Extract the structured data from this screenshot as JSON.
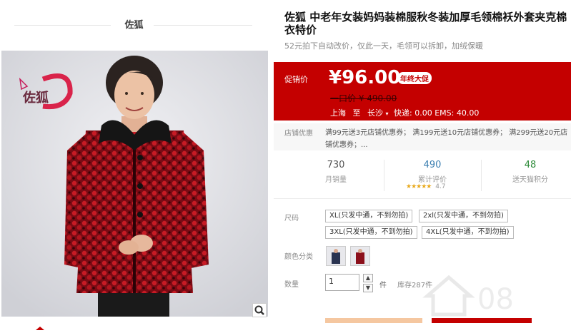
{
  "shop": {
    "name": "佐狐"
  },
  "product": {
    "title": "佐狐 中老年女装妈妈装棉服秋冬装加厚毛领棉袄外套夹克棉衣特价",
    "subtitle": "52元拍下自动改价，仅此一天，毛领可以拆卸，加绒保暖",
    "logo_text": "佐狐"
  },
  "price": {
    "promo_label": "促销价",
    "value": "¥96.00",
    "badge": "年终大促",
    "original": "一口价 ¥ 490.00",
    "shipping_from": "上海",
    "shipping_to_word": "至",
    "shipping_dest": "长沙",
    "shipping_text": "快递: 0.00 EMS: 40.00"
  },
  "coupon": {
    "label": "店铺优惠",
    "text": "满99元送3元店铺优惠券； 满199元送10元店铺优惠券； 满299元送20元店铺优惠券；..."
  },
  "stats": [
    {
      "value": "730",
      "label": "月销量",
      "color": "#555555"
    },
    {
      "value": "490",
      "label": "累计评价",
      "color": "#3c7fb1",
      "rating": "4.7",
      "stars": 5
    },
    {
      "value": "48",
      "label": "送天猫积分",
      "color": "#2e8b3a"
    }
  ],
  "options": {
    "size_label": "尺码",
    "sizes": [
      "XL(只发中通，不到勿拍)",
      "2xl(只发中通，不到勿拍)",
      "3XL(只发中通，不到勿拍)",
      "4XL(只发中通，不到勿拍)"
    ],
    "color_label": "颜色分类"
  },
  "quantity": {
    "label": "数量",
    "value": "1",
    "unit": "件",
    "stock": "库存287件"
  },
  "watermark": "08"
}
